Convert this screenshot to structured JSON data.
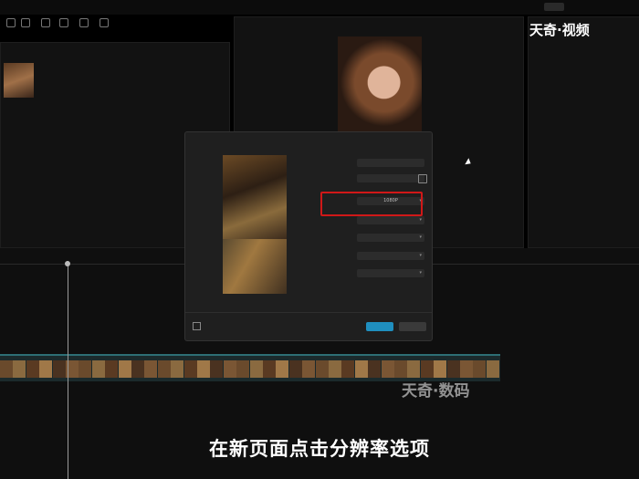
{
  "app_title": "",
  "export_button": "",
  "toolbar": {
    "tools": [
      "",
      "",
      "",
      "",
      "",
      ""
    ]
  },
  "media": {
    "clip_duration": "",
    "sort_label": ""
  },
  "player": {
    "title": ""
  },
  "details": {
    "title": "",
    "rows": []
  },
  "export_dialog": {
    "title": "",
    "thumb_caption": "",
    "rows": {
      "name_label": "",
      "name_value": "",
      "path_label": "",
      "path_value": "",
      "resolution_label": "",
      "resolution_value": "1080P",
      "bitrate_label": "",
      "bitrate_value": "",
      "codec_label": "",
      "codec_value": "",
      "format_label": "",
      "format_value": "",
      "fps_label": "",
      "fps_value": ""
    },
    "note": "",
    "footer_info": "",
    "size_info": "",
    "export_button": "",
    "cancel_button": ""
  },
  "timeline": {
    "clip_label": ""
  },
  "watermarks": {
    "top_right": "天奇·视频",
    "center": "天奇·数码"
  },
  "subtitle": "在新页面点击分辨率选项"
}
